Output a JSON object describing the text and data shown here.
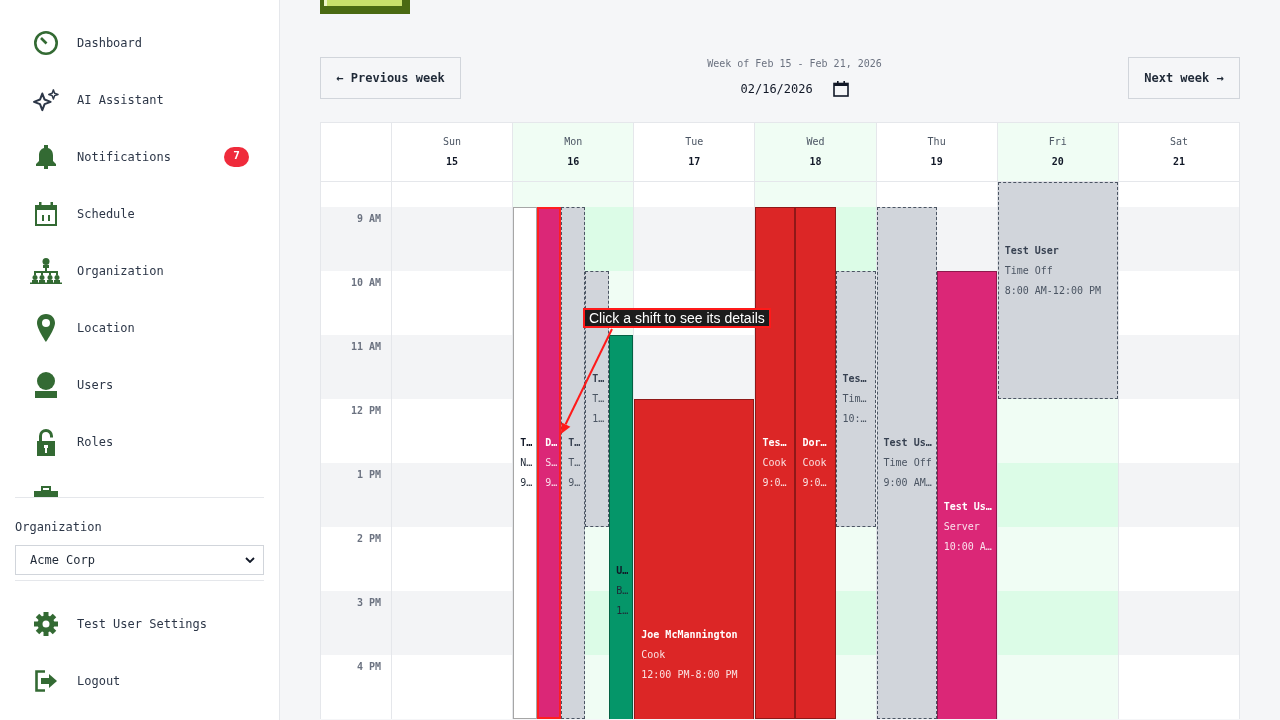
{
  "sidebar": {
    "nav_items": [
      {
        "label": "Dashboard"
      },
      {
        "label": "AI Assistant"
      },
      {
        "label": "Notifications",
        "badge": "7"
      },
      {
        "label": "Schedule"
      },
      {
        "label": "Organization"
      },
      {
        "label": "Location"
      },
      {
        "label": "Users"
      },
      {
        "label": "Roles"
      }
    ],
    "organization": {
      "label": "Organization",
      "value": "Acme Corp"
    },
    "footer_items": [
      {
        "label": "Test User Settings"
      },
      {
        "label": "Logout"
      }
    ]
  },
  "week_nav": {
    "previous": "← Previous week",
    "title": "Week of Feb 15 - Feb 21, 2026",
    "date": "02/16/2026",
    "next": "Next week →"
  },
  "calendar": {
    "hours": [
      "9 AM",
      "10 AM",
      "11 AM",
      "12 PM",
      "1 PM",
      "2 PM",
      "3 PM",
      "4 PM"
    ],
    "days": [
      {
        "name": "Sun",
        "date": "15",
        "highlighted": false
      },
      {
        "name": "Mon",
        "date": "16",
        "highlighted": true,
        "events": [
          {
            "kind": "shift",
            "color": "#ffffff",
            "name": "T…",
            "role": "N…",
            "time": "9…",
            "highlighted": false
          },
          {
            "kind": "shift",
            "color": "#db2777",
            "name": "D…",
            "role": "S…",
            "time": "9…",
            "highlighted": true
          },
          {
            "kind": "time_off",
            "name": "T…",
            "role": "T…",
            "time": "9…",
            "highlighted": false
          },
          {
            "kind": "time_off",
            "name": "T…",
            "role": "T…",
            "time": "1…",
            "highlighted": false
          },
          {
            "kind": "shift",
            "color": "#059669",
            "name": "U…",
            "role": "B…",
            "time": "1…",
            "highlighted": false
          }
        ]
      },
      {
        "name": "Tue",
        "date": "17",
        "highlighted": false,
        "events": [
          {
            "kind": "shift",
            "color": "#dc2626",
            "name": "Joe McMannington",
            "role": "Cook",
            "time": "12:00 PM-8:00 PM",
            "highlighted": false
          }
        ]
      },
      {
        "name": "Wed",
        "date": "18",
        "highlighted": true,
        "events": [
          {
            "kind": "shift",
            "color": "#dc2626",
            "name": "Tes…",
            "role": "Cook",
            "time": "9:0…",
            "highlighted": false
          },
          {
            "kind": "shift",
            "color": "#dc2626",
            "name": "Dor…",
            "role": "Cook",
            "time": "9:0…",
            "highlighted": false
          },
          {
            "kind": "time_off",
            "name": "Tes…",
            "role": "Tim…",
            "time": "10:…",
            "highlighted": false
          }
        ]
      },
      {
        "name": "Thu",
        "date": "19",
        "highlighted": false,
        "events": [
          {
            "kind": "time_off",
            "name": "Test Us…",
            "role": "Time Off",
            "time": "9:00 AM…",
            "highlighted": false
          },
          {
            "kind": "shift",
            "color": "#db2777",
            "name": "Test Us…",
            "role": "Server",
            "time": "10:00 A…",
            "highlighted": false
          }
        ]
      },
      {
        "name": "Fri",
        "date": "20",
        "highlighted": true,
        "events": [
          {
            "kind": "time_off",
            "name": "Test User",
            "role": "Time Off",
            "time": "8:00 AM-12:00 PM",
            "highlighted": false
          }
        ]
      },
      {
        "name": "Sat",
        "date": "21",
        "highlighted": false
      }
    ],
    "callout": {
      "text": "Click a shift to see its details"
    }
  }
}
